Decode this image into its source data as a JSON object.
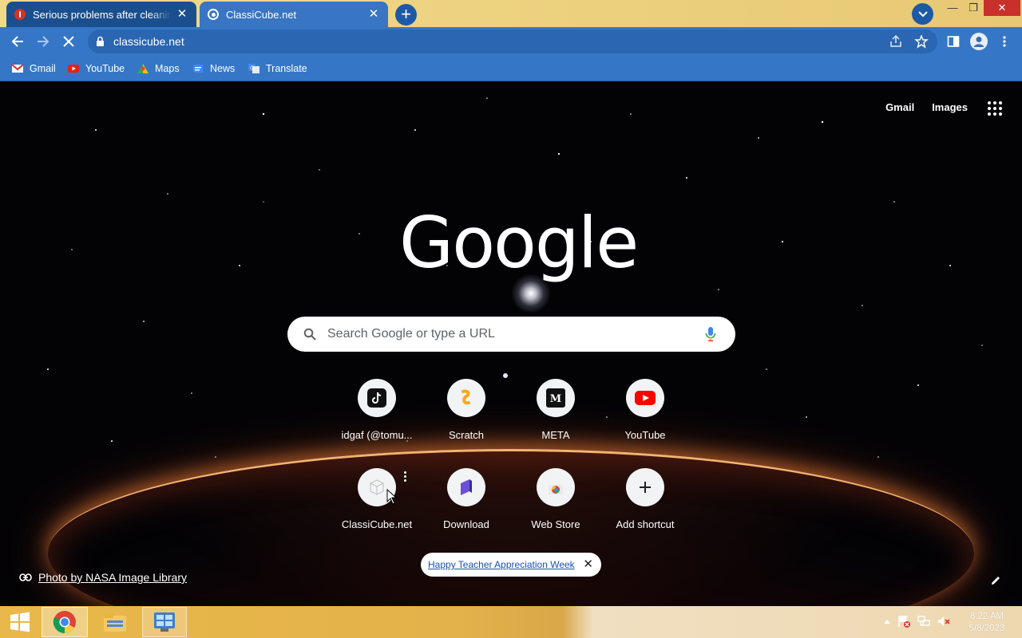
{
  "tabs": [
    {
      "title": "Serious problems after cleaning computer",
      "close": "✕"
    },
    {
      "title": "ClassiCube.net",
      "close": "✕"
    }
  ],
  "new_tab_label": "+",
  "window_controls": {
    "minimize": "—",
    "maximize": "❐",
    "close": "✕"
  },
  "address_bar": {
    "url": "classicube.net"
  },
  "bookmarks": [
    "Gmail",
    "YouTube",
    "Maps",
    "News",
    "Translate"
  ],
  "ntp": {
    "top_links": [
      "Gmail",
      "Images"
    ],
    "logo": "Google",
    "search_placeholder": "Search Google or type a URL",
    "shortcuts": [
      {
        "label": "idgaf (@tomu...",
        "icon": "tiktok-icon"
      },
      {
        "label": "Scratch",
        "icon": "scratch-icon"
      },
      {
        "label": "META",
        "icon": "meta-icon"
      },
      {
        "label": "YouTube",
        "icon": "youtube-icon"
      },
      {
        "label": "ClassiCube.net",
        "icon": "classicube-icon"
      },
      {
        "label": "Download",
        "icon": "download-icon"
      },
      {
        "label": "Web Store",
        "icon": "web-store-icon"
      },
      {
        "label": "Add shortcut",
        "icon": "plus-icon"
      }
    ],
    "promo_text": "Happy Teacher Appreciation Week",
    "promo_close": "✕",
    "attribution": "Photo by NASA Image Library"
  },
  "taskbar": {
    "clock_time": "8:22 AM",
    "clock_date": "5/8/2023"
  },
  "colors": {
    "toolbar": "#3577c6",
    "active_tab": "#3875c2",
    "inactive_tab": "#1a4f8e",
    "tabstrip": "#ecd07e"
  }
}
